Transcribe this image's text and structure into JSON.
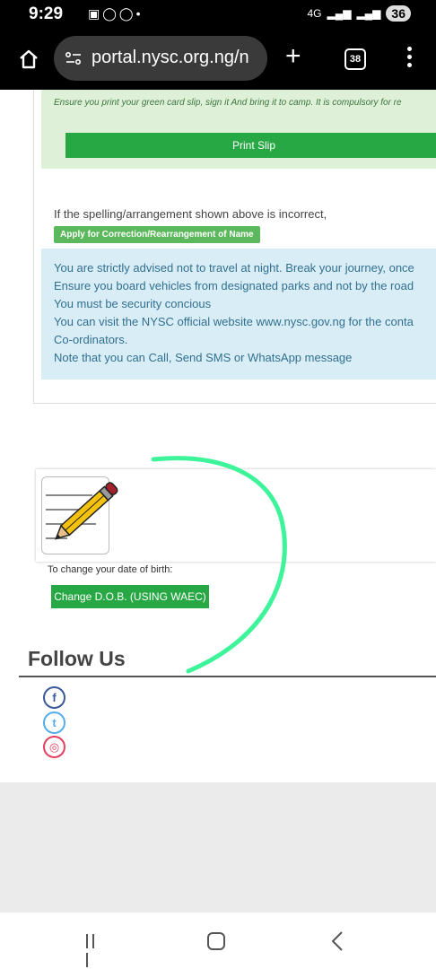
{
  "status_bar": {
    "time": "9:29",
    "network": "4G",
    "battery": "36"
  },
  "browser": {
    "url": "portal.nysc.org.ng/n",
    "tab_count": "38",
    "home_icon": "home-icon",
    "new_tab_icon": "plus-icon",
    "menu_icon": "more-vertical-icon"
  },
  "notice": {
    "print_note": "Ensure you print your green card slip, sign it And bring it to camp. It is compulsory for re",
    "print_button": "Print Slip"
  },
  "correction": {
    "text": "If the spelling/arrangement shown above is incorrect,",
    "button": "Apply for Correction/Rearrangement of Name"
  },
  "advisory": {
    "lines": [
      "You are strictly advised not to travel at night. Break your journey, once",
      "Ensure you board vehicles from designated parks and not by the road",
      "You must be security concious",
      "You can visit the NYSC official website www.nysc.gov.ng for the conta",
      "Co-ordinators.",
      "Note that you can Call, Send SMS or WhatsApp message"
    ]
  },
  "dob": {
    "icon": "pencil-notepad-icon",
    "label": "To change your date of birth:",
    "button": "Change D.O.B. (USING WAEC)"
  },
  "follow": {
    "title": "Follow Us",
    "icons": [
      "facebook-icon",
      "twitter-icon",
      "instagram-icon"
    ],
    "glyphs": [
      "f",
      "t",
      "◎"
    ]
  },
  "colors": {
    "success_bg": "#dff0d8",
    "info_bg": "#d9edf7",
    "button_green": "#28a745",
    "scribble": "#3ef49a"
  }
}
